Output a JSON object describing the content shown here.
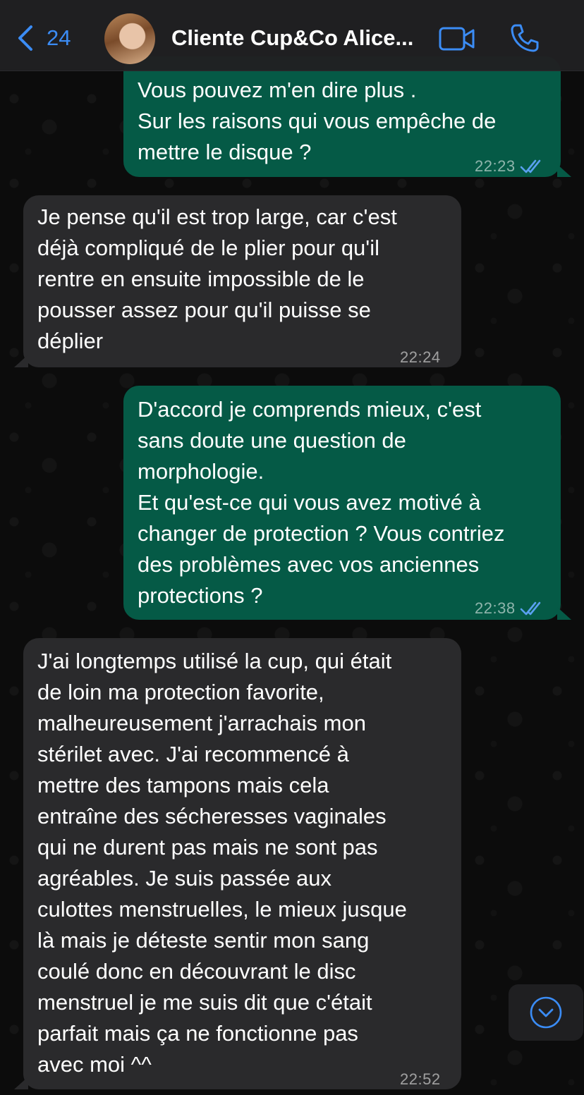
{
  "header": {
    "back_count": "24",
    "contact_name": "Cliente Cup&Co Alice...",
    "icons": {
      "back": "chevron-left-icon",
      "video": "video-call-icon",
      "phone": "phone-call-icon"
    },
    "accent_color": "#3b8cf5"
  },
  "colors": {
    "outgoing_bubble": "#055a46",
    "incoming_bubble": "#2a2a2c",
    "read_ticks": "#5aa0f0"
  },
  "messages": [
    {
      "direction": "outgoing",
      "lines": [
        "Vous pouvez m'en dire plus .",
        "Sur les raisons qui vous empêche de",
        "mettre le disque ?"
      ],
      "time": "22:23",
      "status": "read"
    },
    {
      "direction": "incoming",
      "lines": [
        "Je pense qu'il est trop large, car c'est",
        "déjà compliqué de le plier pour qu'il",
        "rentre en ensuite impossible de le",
        "pousser assez pour qu'il puisse se",
        "déplier"
      ],
      "time": "22:24"
    },
    {
      "direction": "outgoing",
      "lines": [
        "D'accord je comprends mieux, c'est",
        "sans doute une question de",
        "morphologie.",
        "Et qu'est-ce qui vous avez motivé à",
        "changer de protection ? Vous contriez",
        "des problèmes avec vos anciennes",
        "protections ?"
      ],
      "time": "22:38",
      "status": "read"
    },
    {
      "direction": "incoming",
      "lines": [
        "J'ai longtemps utilisé la cup, qui était",
        "de loin ma protection favorite,",
        "malheureusement j'arrachais mon",
        "stérilet avec. J'ai recommencé à",
        "mettre des tampons mais cela",
        "entraîne des sécheresses vaginales",
        "qui ne durent pas mais ne sont pas",
        "agréables. Je suis passée aux",
        "culottes menstruelles, le mieux jusque",
        "là mais je déteste sentir mon sang",
        "coulé donc en découvrant le disc",
        "menstruel je me suis dit que c'était",
        "parfait mais ça ne fonctionne pas",
        "avec moi ^^"
      ],
      "time": "22:52"
    }
  ],
  "scroll_button": {
    "icon": "chevron-down-circle-icon"
  }
}
